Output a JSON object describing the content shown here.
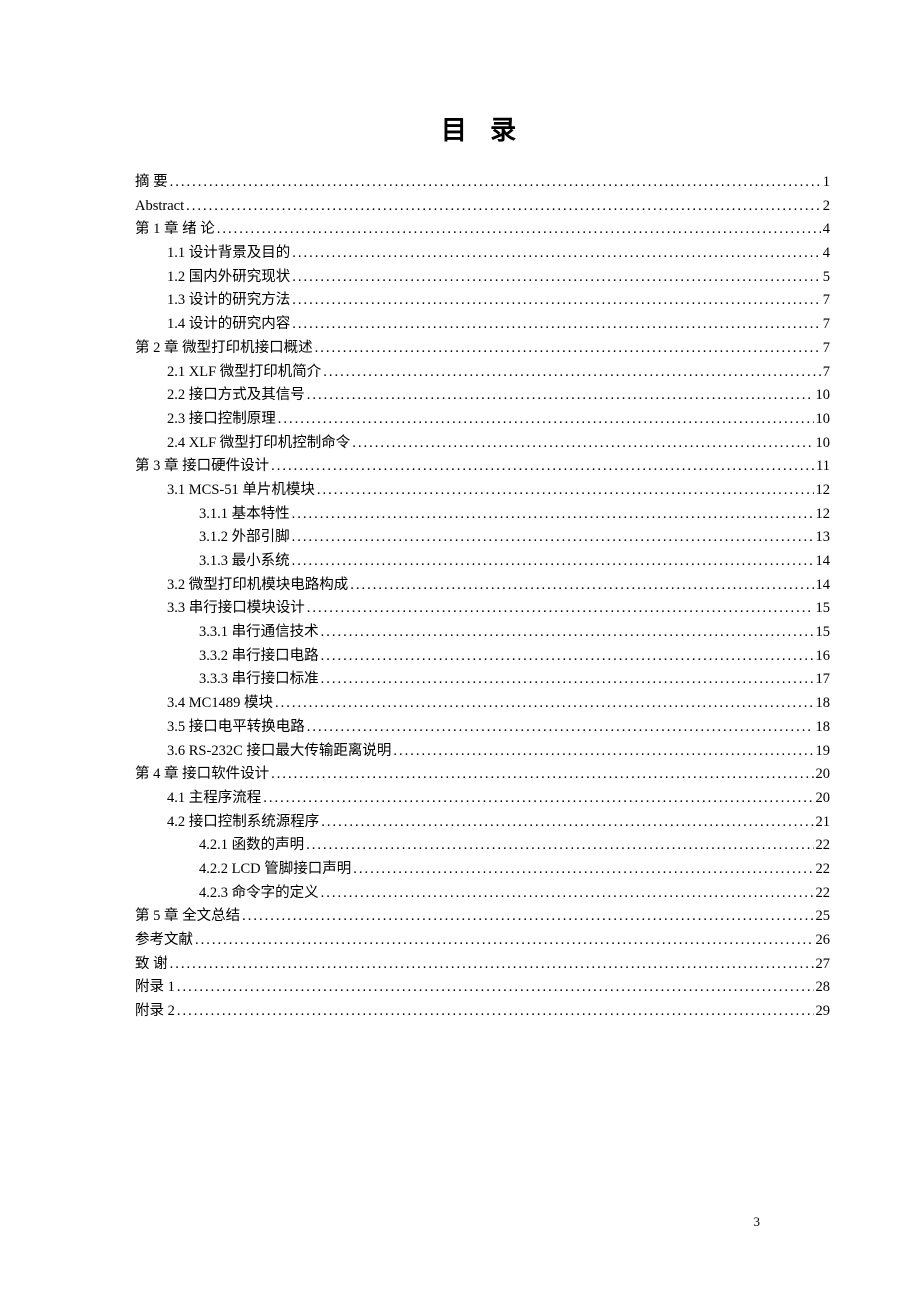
{
  "title": "目 录",
  "page_number": "3",
  "toc": [
    {
      "label": "摘 要",
      "page": "1",
      "indent": 0
    },
    {
      "label": "Abstract",
      "page": "2",
      "indent": 0,
      "en": true
    },
    {
      "label": "第 1 章 绪 论",
      "page": "4",
      "indent": 0
    },
    {
      "label": "1.1 设计背景及目的",
      "page": "4",
      "indent": 1
    },
    {
      "label": "1.2 国内外研究现状",
      "page": "5",
      "indent": 1
    },
    {
      "label": "1.3 设计的研究方法",
      "page": "7",
      "indent": 1
    },
    {
      "label": "1.4 设计的研究内容",
      "page": "7",
      "indent": 1
    },
    {
      "label": "第 2 章 微型打印机接口概述",
      "page": "7",
      "indent": 0
    },
    {
      "label": "2.1 XLF 微型打印机简介",
      "page": "7",
      "indent": 1
    },
    {
      "label": "2.2 接口方式及其信号",
      "page": "10",
      "indent": 1
    },
    {
      "label": "2.3 接口控制原理",
      "page": "10",
      "indent": 1
    },
    {
      "label": "2.4 XLF 微型打印机控制命令",
      "page": "10",
      "indent": 1
    },
    {
      "label": "第 3 章 接口硬件设计",
      "page": "11",
      "indent": 0
    },
    {
      "label": "3.1 MCS-51 单片机模块",
      "page": "12",
      "indent": 1
    },
    {
      "label": "3.1.1 基本特性",
      "page": "12",
      "indent": 2
    },
    {
      "label": "3.1.2 外部引脚",
      "page": "13",
      "indent": 2
    },
    {
      "label": "3.1.3 最小系统",
      "page": "14",
      "indent": 2
    },
    {
      "label": "3.2 微型打印机模块电路构成",
      "page": "14",
      "indent": 1
    },
    {
      "label": "3.3 串行接口模块设计",
      "page": "15",
      "indent": 1
    },
    {
      "label": "3.3.1 串行通信技术",
      "page": "15",
      "indent": 2
    },
    {
      "label": "3.3.2 串行接口电路",
      "page": "16",
      "indent": 2
    },
    {
      "label": "3.3.3 串行接口标准",
      "page": "17",
      "indent": 2
    },
    {
      "label": "3.4 MC1489 模块",
      "page": "18",
      "indent": 1
    },
    {
      "label": "3.5 接口电平转换电路",
      "page": "18",
      "indent": 1
    },
    {
      "label": "3.6 RS-232C 接口最大传输距离说明",
      "page": "19",
      "indent": 1
    },
    {
      "label": "第 4 章 接口软件设计",
      "page": "20",
      "indent": 0
    },
    {
      "label": "4.1 主程序流程",
      "page": "20",
      "indent": 1
    },
    {
      "label": "4.2 接口控制系统源程序",
      "page": "21",
      "indent": 1
    },
    {
      "label": "4.2.1 函数的声明",
      "page": "22",
      "indent": 2
    },
    {
      "label": "4.2.2 LCD 管脚接口声明",
      "page": "22",
      "indent": 2
    },
    {
      "label": "4.2.3 命令字的定义",
      "page": "22",
      "indent": 2
    },
    {
      "label": "第 5 章 全文总结",
      "page": "25",
      "indent": 0
    },
    {
      "label": "参考文献",
      "page": "26",
      "indent": 0
    },
    {
      "label": "致 谢",
      "page": "27",
      "indent": 0
    },
    {
      "label": "附录 1",
      "page": "28",
      "indent": 0
    },
    {
      "label": "附录 2",
      "page": "29",
      "indent": 0
    }
  ]
}
